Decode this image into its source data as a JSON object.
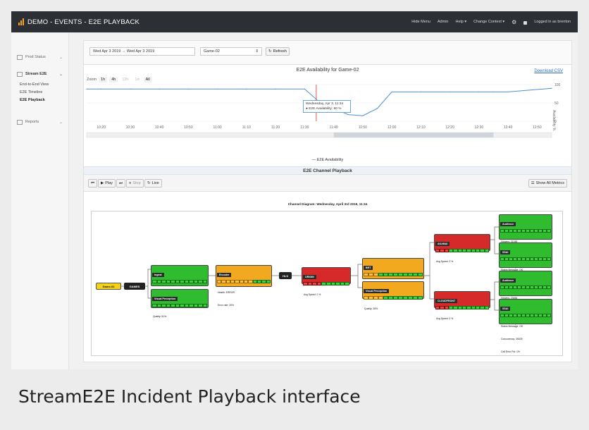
{
  "app": {
    "title": "DEMO - EVENTS - E2E PLAYBACK",
    "nav": [
      "Hide Menu",
      "Admin",
      "Help ▾",
      "Change Context ▾"
    ],
    "user": "Logged in as brenton"
  },
  "sidebar": {
    "sections": [
      {
        "label": "Prod Status",
        "items": []
      },
      {
        "label": "Stream E2E",
        "items": [
          "End-to-End View",
          "E2E Timeline",
          "E2E Playback"
        ]
      },
      {
        "label": "Reports",
        "items": []
      }
    ],
    "active_item": "E2E Playback"
  },
  "controls": {
    "date_range": "Wed Apr 3 2019  →  Wed Apr 3 2019",
    "channel": "Game-02",
    "refresh_label": "Refresh"
  },
  "chart_panel": {
    "title": "E2E Availability for Game-02",
    "download": "Download CSV",
    "zoom_label": "Zoom",
    "zoom_options": [
      "1h",
      "4h",
      "12h",
      "1d",
      "All"
    ],
    "y_axis_label": "Availability %",
    "tooltip_line1": "Wednesday, Apr 3, 11:34",
    "tooltip_line2": "● E2E Availability: 60 %",
    "legend": "— E2E Availability"
  },
  "chart_data": {
    "type": "line",
    "title": "E2E Availability for Game-02",
    "ylabel": "Availability %",
    "x": [
      "10:15",
      "10:20",
      "10:30",
      "10:40",
      "10:50",
      "11:00",
      "11:10",
      "11:20",
      "11:30",
      "11:34",
      "11:36",
      "11:40",
      "11:45",
      "11:50",
      "11:55",
      "12:00",
      "12:10",
      "12:20",
      "12:30",
      "12:35",
      "12:40",
      "12:55"
    ],
    "ytick_labels": [
      "0",
      "50",
      "100"
    ],
    "xtick_labels": [
      "10:20",
      "10:30",
      "10:40",
      "10:50",
      "11:00",
      "11:10",
      "11:20",
      "11:30",
      "11:40",
      "11:50",
      "12:00",
      "12:10",
      "12:20",
      "12:30",
      "12:40",
      "12:50"
    ],
    "series": [
      {
        "name": "E2E Availability",
        "values": [
          88,
          88,
          88,
          88,
          88,
          88,
          88,
          88,
          88,
          60,
          40,
          35,
          18,
          15,
          35,
          80,
          80,
          80,
          80,
          80,
          80,
          90
        ]
      }
    ],
    "ylim": [
      0,
      100
    ],
    "legend": "bottom-center"
  },
  "playback": {
    "title": "E2E Channel Playback",
    "buttons": [
      "Play",
      "Stop",
      "Live"
    ],
    "show_all": "Show All Metrics",
    "diagram_title": "Channel Diagram: Wednesday, April 3rd 2019, 11:34"
  },
  "nodes": {
    "game": "Game-02",
    "games": "GAMES",
    "ingest": {
      "title": "Ingest",
      "health": "Health: GOOD",
      "status": "Status Message: No problems found"
    },
    "visual1": {
      "title": "Visual Perception",
      "quality": "Quality: 81%"
    },
    "encoder": {
      "title": "Encoder",
      "health": "Health: ERROR",
      "error": "Error rate: 20%"
    },
    "hls": "HLS",
    "origin": {
      "title": "ORIGIN",
      "speed": "Avg Speed: 2 %"
    },
    "brt": {
      "title": "BRT",
      "akamai": "Akamai: 50%",
      "cloudfront": "Cloudfront: 50 %"
    },
    "visual2": {
      "title": "Visual Perception",
      "quality": "Quality: 38%"
    },
    "akamai": {
      "title": "AKAMAI",
      "speed": "Avg Speed: 2 %"
    },
    "cloudfront": {
      "title": "CLOUDFRONT",
      "speed": "Avg Speed: 0 %"
    },
    "aud1": {
      "title": "Audience",
      "viewers": "Viewers: 21045",
      "buffer": "Buffer Ratio: 31%",
      "error": "Error Rate: 0 per sec"
    },
    "ssai1": {
      "title": "SSAI",
      "status": "Status Message: OK",
      "concurrency": "Concurrency: 17029",
      "callerr": "Call Error Pct: 8%"
    },
    "aud2": {
      "title": "Audience",
      "viewers": "Viewers: 23456",
      "buffer": "Buffer Ratio: 28%",
      "error": "Error Rate: 0 per sec"
    },
    "ssai2": {
      "title": "SSAI",
      "status": "Status Message: OK",
      "concurrency": "Concurrency: 39025",
      "callerr": "Call Error Pct: 1%"
    }
  },
  "caption": "StreamE2E Incident Playback interface",
  "colors": {
    "topbar": "#2c2f33",
    "brand_accent": "#f5a623",
    "line": "#4a90d9",
    "green": "#2fbd2f",
    "orange": "#f2a91f",
    "red": "#d62a2a"
  }
}
